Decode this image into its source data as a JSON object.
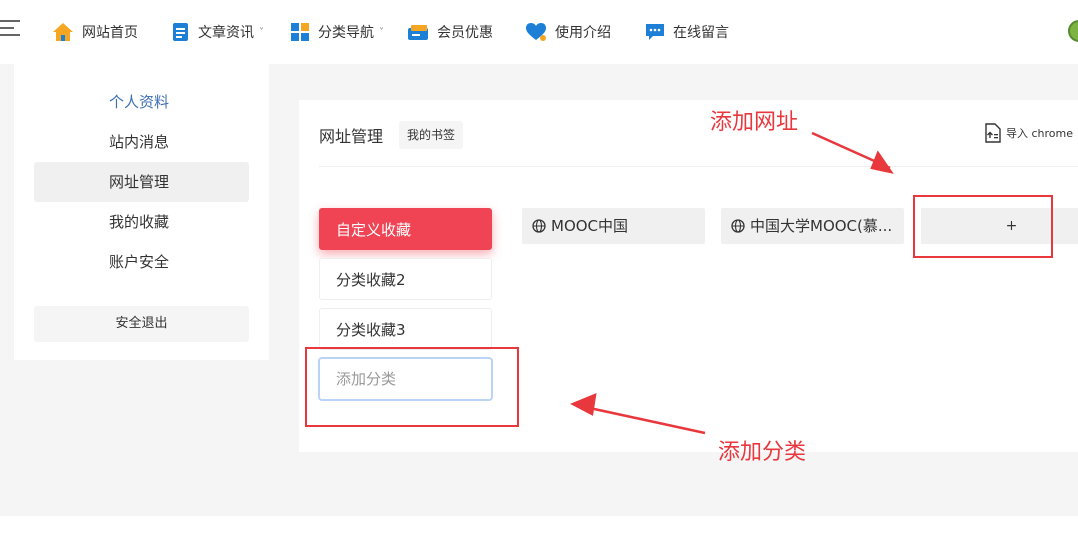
{
  "nav": {
    "items": [
      {
        "label": "网站首页",
        "icon": "home-icon"
      },
      {
        "label": "文章资讯",
        "icon": "document-icon",
        "caret": "˅"
      },
      {
        "label": "分类导航",
        "icon": "grid-icon",
        "caret": "˅"
      },
      {
        "label": "会员优惠",
        "icon": "ticket-icon"
      },
      {
        "label": "使用介绍",
        "icon": "heart-icon"
      },
      {
        "label": "在线留言",
        "icon": "chat-icon"
      }
    ]
  },
  "sidebar": {
    "items": [
      {
        "label": "个人资料"
      },
      {
        "label": "站内消息"
      },
      {
        "label": "网址管理"
      },
      {
        "label": "我的收藏"
      },
      {
        "label": "账户安全"
      }
    ],
    "logout_label": "安全退出"
  },
  "panel": {
    "title": "网址管理",
    "bookmark_tag": "我的书签",
    "import_label": "导入 chrome",
    "categories": [
      {
        "label": "自定义收藏"
      },
      {
        "label": "分类收藏2"
      },
      {
        "label": "分类收藏3"
      }
    ],
    "add_category_placeholder": "添加分类",
    "sites": [
      {
        "label": "MOOC中国"
      },
      {
        "label": "中国大学MOOC(慕..."
      }
    ],
    "add_site_label": "+"
  },
  "annotations": {
    "add_url": "添加网址",
    "add_category": "添加分类"
  },
  "colors": {
    "accent_red": "#f04455",
    "annotation_red": "#e8383d",
    "link_blue": "#3d6fb4",
    "icon_blue": "#1e7fd6"
  }
}
